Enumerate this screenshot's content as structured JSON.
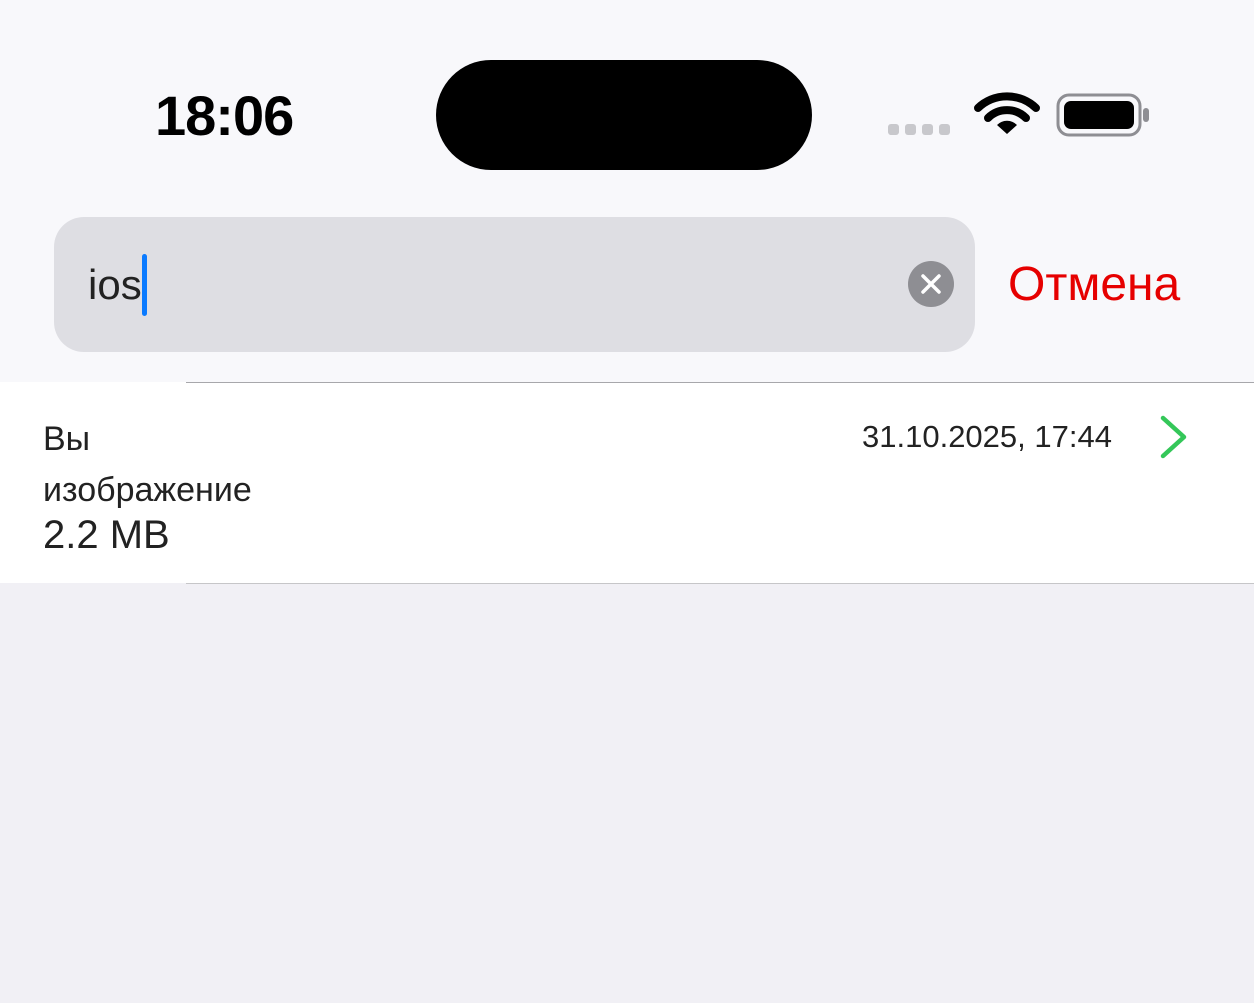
{
  "status_bar": {
    "time": "18:06",
    "wifi_icon": "wifi-icon",
    "battery_icon": "battery-icon",
    "signal_icon": "cellular-signal-icon"
  },
  "search": {
    "query": "ios",
    "clear_icon": "clear-circle-icon",
    "cancel_label": "Отмена"
  },
  "results": [
    {
      "title": "Вы изображение",
      "size": "2.2 MB",
      "date": "31.10.2025, 17:44",
      "chevron_icon": "chevron-right-icon"
    }
  ],
  "colors": {
    "cancel": "#e60000",
    "caret": "#0a7aff",
    "chevron": "#34c759"
  }
}
